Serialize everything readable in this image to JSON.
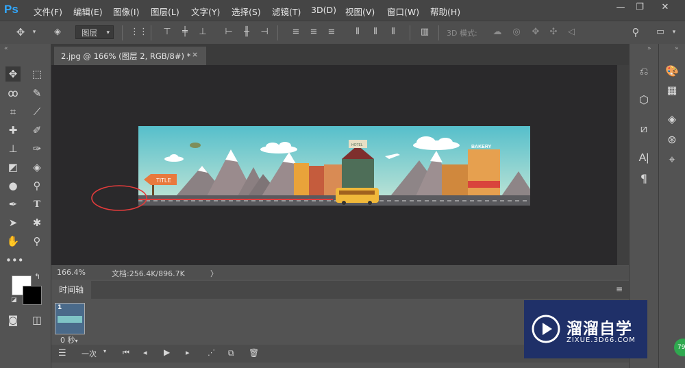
{
  "app": {
    "logo": "Ps"
  },
  "menu": [
    "文件(F)",
    "编辑(E)",
    "图像(I)",
    "图层(L)",
    "文字(Y)",
    "选择(S)",
    "滤镜(T)",
    "3D(D)",
    "视图(V)",
    "窗口(W)",
    "帮助(H)"
  ],
  "window_controls": {
    "minimize": "—",
    "restore": "❐",
    "close": "✕"
  },
  "options_bar": {
    "layer_select": "图层",
    "mode_3d_label": "3D 模式:"
  },
  "document_tab": {
    "title": "2.jpg @ 166% (图层 2, RGB/8#) *",
    "close": "×"
  },
  "status": {
    "zoom": "166.4%",
    "doc_info": "文档:256.4K/896.7K",
    "arrow": "〉"
  },
  "timeline": {
    "tab_label": "时间轴",
    "frame_number": "1",
    "frame_delay": "0 秒",
    "loop_label": "一次"
  },
  "banner": {
    "sign_text": "TITLE",
    "hotel_text": "HOTEL",
    "bakery_text": "BAKERY"
  },
  "watermark": {
    "title": "溜溜自学",
    "url": "ZIXUE.3D66.COM",
    "badge": "79"
  },
  "colors": {
    "accent": "#31a8ff",
    "sky": "#5fc0c8",
    "annotation": "#e23b3b"
  }
}
